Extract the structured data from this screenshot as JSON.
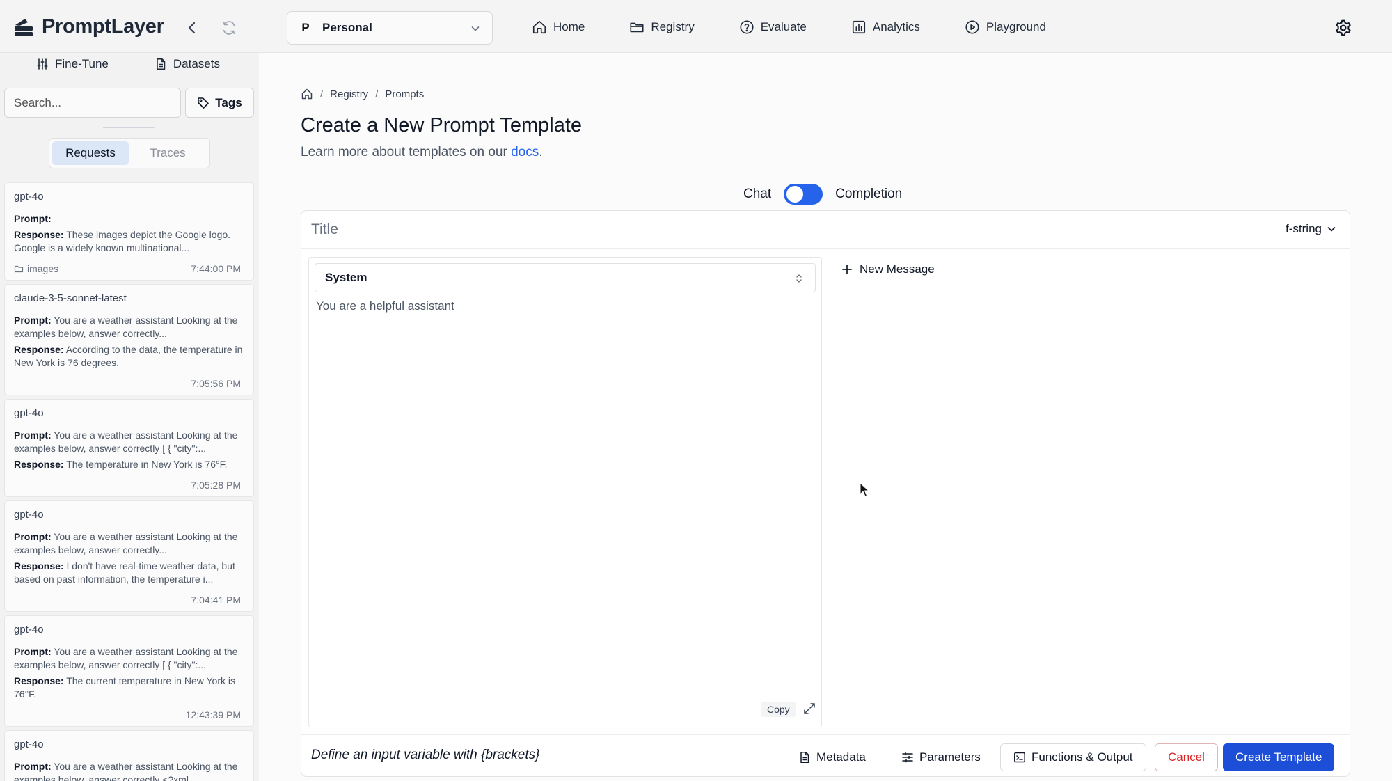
{
  "app": {
    "name": "PromptLayer"
  },
  "header": {
    "workspace": {
      "avatar": "P",
      "name": "Personal"
    },
    "nav": [
      {
        "label": "Home",
        "icon": "home-icon"
      },
      {
        "label": "Registry",
        "icon": "folder-icon"
      },
      {
        "label": "Evaluate",
        "icon": "help-circle-icon"
      },
      {
        "label": "Analytics",
        "icon": "bar-chart-icon"
      },
      {
        "label": "Playground",
        "icon": "play-circle-icon"
      }
    ]
  },
  "sidebar": {
    "links": [
      {
        "label": "Fine-Tune",
        "icon": "sliders-icon"
      },
      {
        "label": "Datasets",
        "icon": "file-icon"
      }
    ],
    "search_placeholder": "Search...",
    "tags_label": "Tags",
    "tabs": {
      "active": "Requests",
      "inactive": "Traces"
    },
    "requests": [
      {
        "model": "gpt-4o",
        "prompt_label": "Prompt:",
        "prompt": "",
        "response_label": "Response:",
        "response": "These images depict the Google logo. Google is a widely known multinational...",
        "tag": "images",
        "time": "7:44:00 PM"
      },
      {
        "model": "claude-3-5-sonnet-latest",
        "prompt_label": "Prompt:",
        "prompt": "You are a weather assistant Looking at the examples below, answer correctly...",
        "response_label": "Response:",
        "response": "According to the data, the temperature in New York is 76 degrees.",
        "time": "7:05:56 PM"
      },
      {
        "model": "gpt-4o",
        "prompt_label": "Prompt:",
        "prompt": "You are a weather assistant Looking at the examples below, answer correctly [ { \"city\":...",
        "response_label": "Response:",
        "response": "The temperature in New York is 76°F.",
        "time": "7:05:28 PM"
      },
      {
        "model": "gpt-4o",
        "prompt_label": "Prompt:",
        "prompt": "You are a weather assistant Looking at the examples below, answer correctly...",
        "response_label": "Response:",
        "response": "I don't have real-time weather data, but based on past information, the temperature i...",
        "time": "7:04:41 PM"
      },
      {
        "model": "gpt-4o",
        "prompt_label": "Prompt:",
        "prompt": "You are a weather assistant Looking at the examples below, answer correctly [ { \"city\":...",
        "response_label": "Response:",
        "response": "The current temperature in New York is 76°F.",
        "time": "12:43:39 PM"
      },
      {
        "model": "gpt-4o",
        "prompt_label": "Prompt:",
        "prompt": "You are a weather assistant Looking at the examples below, answer correctly <?xml...",
        "response_label": "",
        "response": "",
        "time": ""
      }
    ]
  },
  "main": {
    "breadcrumb": {
      "sep": "/",
      "items": [
        "Registry",
        "Prompts"
      ]
    },
    "title": "Create a New Prompt Template",
    "subtitle_prefix": "Learn more about templates on our ",
    "subtitle_link": "docs",
    "subtitle_suffix": ".",
    "mode": {
      "left": "Chat",
      "right": "Completion",
      "toggle_on": true
    },
    "editor": {
      "title_placeholder": "Title",
      "format": "f-string",
      "message": {
        "role": "System",
        "content": "You are a helpful assistant"
      },
      "copy_label": "Copy",
      "new_message_label": "New Message",
      "hint": "Define an input variable with {brackets}",
      "buttons": {
        "metadata": "Metadata",
        "parameters": "Parameters",
        "functions": "Functions & Output",
        "cancel": "Cancel",
        "create": "Create Template"
      }
    }
  },
  "colors": {
    "accent": "#1d4ed8",
    "toggle": "#2563eb",
    "danger": "#dc2626",
    "link": "#2563eb"
  }
}
